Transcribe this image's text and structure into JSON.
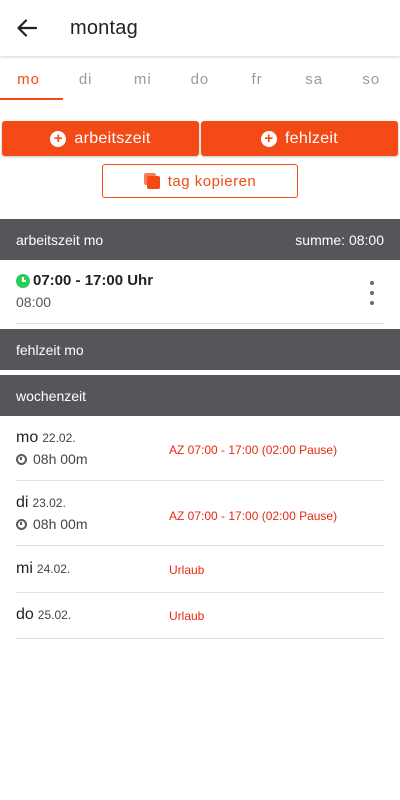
{
  "appbar": {
    "title": "montag",
    "back_icon": "arrow-back-icon"
  },
  "tabs": [
    "mo",
    "di",
    "mi",
    "do",
    "fr",
    "sa",
    "so"
  ],
  "active_tab": "mo",
  "actions": {
    "add_worktime": "arbeitszeit",
    "add_absence": "fehlzeit",
    "copy_day": "tag kopieren"
  },
  "worktime_section": {
    "title": "arbeitszeit mo",
    "sum": "summe: 08:00"
  },
  "worktime_entry": {
    "time_range": "07:00 - 17:00 Uhr",
    "duration": "08:00"
  },
  "absence_section": {
    "title": "fehlzeit mo"
  },
  "week_section": {
    "title": "wochenzeit"
  },
  "week": [
    {
      "day": "mo",
      "date": "22.02.",
      "hours": "08h 00m",
      "status": "AZ 07:00 - 17:00 (02:00 Pause)"
    },
    {
      "day": "di",
      "date": "23.02.",
      "hours": "08h 00m",
      "status": "AZ 07:00 - 17:00 (02:00 Pause)"
    },
    {
      "day": "mi",
      "date": "24.02.",
      "status": "Urlaub"
    },
    {
      "day": "do",
      "date": "25.02.",
      "status": "Urlaub"
    }
  ],
  "colors": {
    "accent": "#f44a15",
    "section_bg": "#54565a",
    "status_red": "#e8290f",
    "clock_green": "#2ecc5a"
  }
}
